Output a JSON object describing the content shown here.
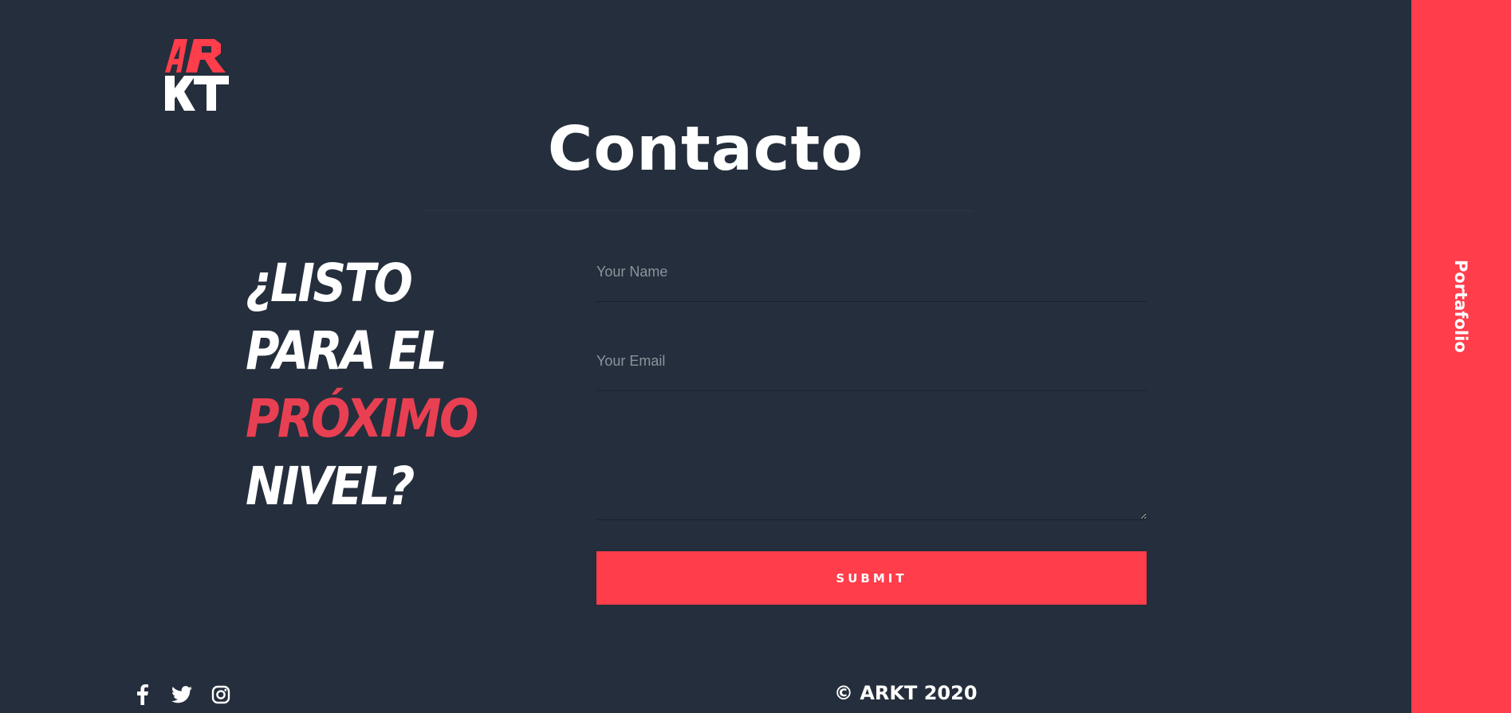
{
  "brand": {
    "logo_alt": "ARKT",
    "accent_color": "#ff3d4b",
    "background_color": "#252e3c"
  },
  "header": {
    "title": "Contacto"
  },
  "tagline": {
    "line1": "¿LISTO",
    "line2": "PARA EL",
    "line3": "PRÓXIMO",
    "line4": "NIVEL?"
  },
  "form": {
    "name_placeholder": "Your Name",
    "name_value": "",
    "email_placeholder": "Your Email",
    "email_value": "",
    "message_value": "",
    "submit_label": "SUBMIT"
  },
  "footer": {
    "social": [
      {
        "icon": "facebook-icon"
      },
      {
        "icon": "twitter-icon"
      },
      {
        "icon": "instagram-icon"
      }
    ],
    "copyright": "© ARKT 2020"
  },
  "side_nav": {
    "label": "Portafolio"
  }
}
